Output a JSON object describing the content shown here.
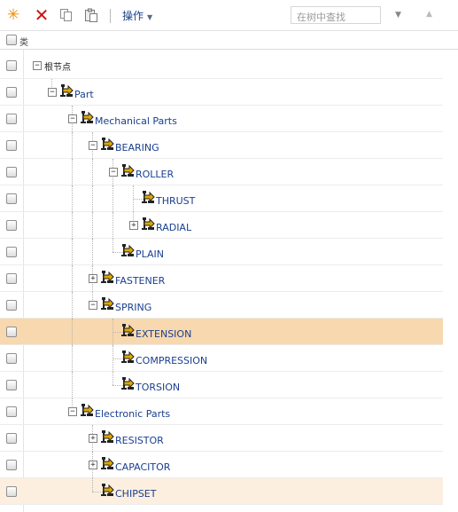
{
  "toolbar": {
    "actions_menu": "操作",
    "search_placeholder": "在树中查找"
  },
  "header": {
    "column_label": "类"
  },
  "tree": [
    {
      "label": "根节点",
      "depth": 0,
      "toggle": "collapse",
      "icon": "none",
      "is_last": true,
      "state": ""
    },
    {
      "label": "Part",
      "depth": 1,
      "toggle": "collapse",
      "icon": "part-class-icon",
      "is_last": true,
      "state": ""
    },
    {
      "label": "Mechanical Parts",
      "depth": 2,
      "toggle": "collapse",
      "icon": "part-class-icon",
      "is_last": false,
      "state": ""
    },
    {
      "label": "BEARING",
      "depth": 3,
      "toggle": "collapse",
      "icon": "part-class-icon",
      "is_last": false,
      "state": ""
    },
    {
      "label": "ROLLER",
      "depth": 4,
      "toggle": "collapse",
      "icon": "part-class-icon",
      "is_last": false,
      "state": ""
    },
    {
      "label": "THRUST",
      "depth": 5,
      "toggle": "none",
      "icon": "part-class-icon",
      "is_last": false,
      "state": ""
    },
    {
      "label": "RADIAL",
      "depth": 5,
      "toggle": "expand",
      "icon": "part-class-icon",
      "is_last": true,
      "state": ""
    },
    {
      "label": "PLAIN",
      "depth": 4,
      "toggle": "none",
      "icon": "part-class-icon",
      "is_last": true,
      "state": ""
    },
    {
      "label": "FASTENER",
      "depth": 3,
      "toggle": "expand",
      "icon": "part-class-icon",
      "is_last": false,
      "state": ""
    },
    {
      "label": "SPRING",
      "depth": 3,
      "toggle": "collapse",
      "icon": "part-class-icon",
      "is_last": true,
      "state": ""
    },
    {
      "label": "EXTENSION",
      "depth": 4,
      "toggle": "none",
      "icon": "part-class-icon",
      "is_last": false,
      "state": "selected"
    },
    {
      "label": "COMPRESSION",
      "depth": 4,
      "toggle": "none",
      "icon": "part-class-icon",
      "is_last": false,
      "state": ""
    },
    {
      "label": "TORSION",
      "depth": 4,
      "toggle": "none",
      "icon": "part-class-icon",
      "is_last": true,
      "state": ""
    },
    {
      "label": "Electronic Parts",
      "depth": 2,
      "toggle": "collapse",
      "icon": "part-class-icon",
      "is_last": true,
      "state": ""
    },
    {
      "label": "RESISTOR",
      "depth": 3,
      "toggle": "expand",
      "icon": "part-class-icon",
      "is_last": false,
      "state": ""
    },
    {
      "label": "CAPACITOR",
      "depth": 3,
      "toggle": "expand",
      "icon": "part-class-icon",
      "is_last": false,
      "state": ""
    },
    {
      "label": "CHIPSET",
      "depth": 3,
      "toggle": "none",
      "icon": "part-class-icon",
      "is_last": true,
      "state": "hover"
    }
  ],
  "colors": {
    "selected_row": "#f8d8ae",
    "hover_row": "#fcefe0",
    "label_text": "#1a3f8f"
  }
}
